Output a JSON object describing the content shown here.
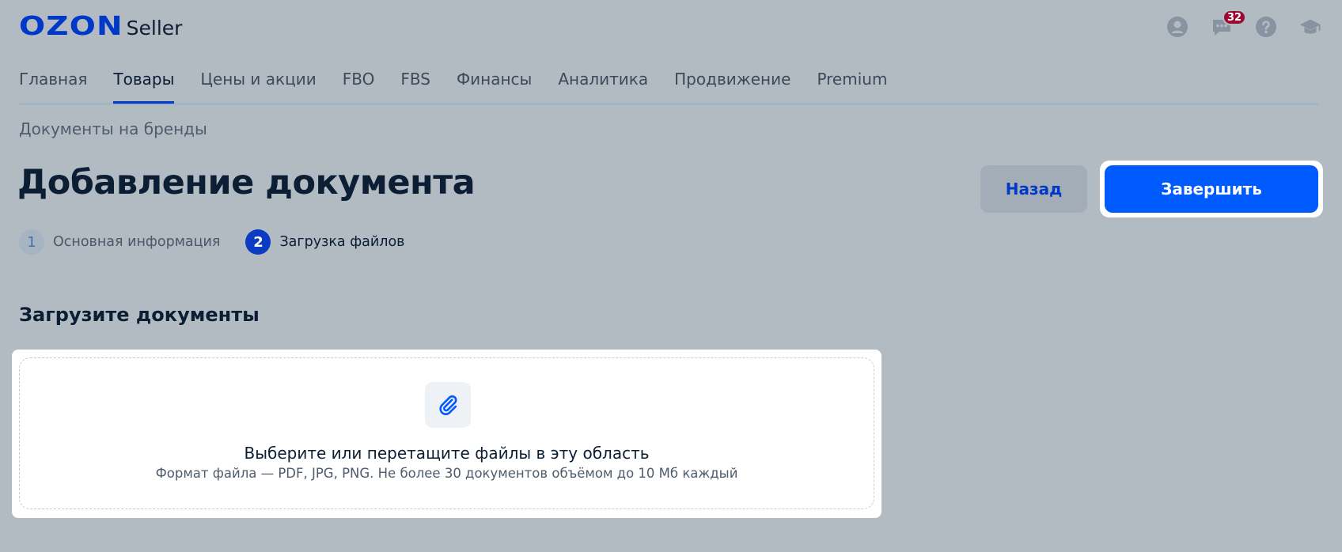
{
  "header": {
    "logo_brand": "OZON",
    "logo_product": "Seller",
    "chat_badge": "32"
  },
  "nav": {
    "items": [
      {
        "label": "Главная"
      },
      {
        "label": "Товары"
      },
      {
        "label": "Цены и акции"
      },
      {
        "label": "FBO"
      },
      {
        "label": "FBS"
      },
      {
        "label": "Финансы"
      },
      {
        "label": "Аналитика"
      },
      {
        "label": "Продвижение"
      },
      {
        "label": "Premium"
      }
    ],
    "active": "Товары"
  },
  "breadcrumb": "Документы на бренды",
  "page": {
    "title": "Добавление документа",
    "back_label": "Назад",
    "finish_label": "Завершить"
  },
  "steps": [
    {
      "number": "1",
      "label": "Основная информация"
    },
    {
      "number": "2",
      "label": "Загрузка файлов"
    }
  ],
  "upload": {
    "section_title": "Загрузите документы",
    "drop_title": "Выберите или перетащите файлы в эту область",
    "drop_hint": "Формат файла — PDF, JPG, PNG. Не более 30 документов объёмом до 10 Мб каждый"
  },
  "colors": {
    "background": "#b2bac2",
    "brand_blue": "#0039c8",
    "primary_button": "#005bff",
    "badge": "#9c0a33"
  },
  "icons": [
    "profile-icon",
    "chat-icon",
    "help-icon",
    "education-icon",
    "paperclip-icon"
  ]
}
